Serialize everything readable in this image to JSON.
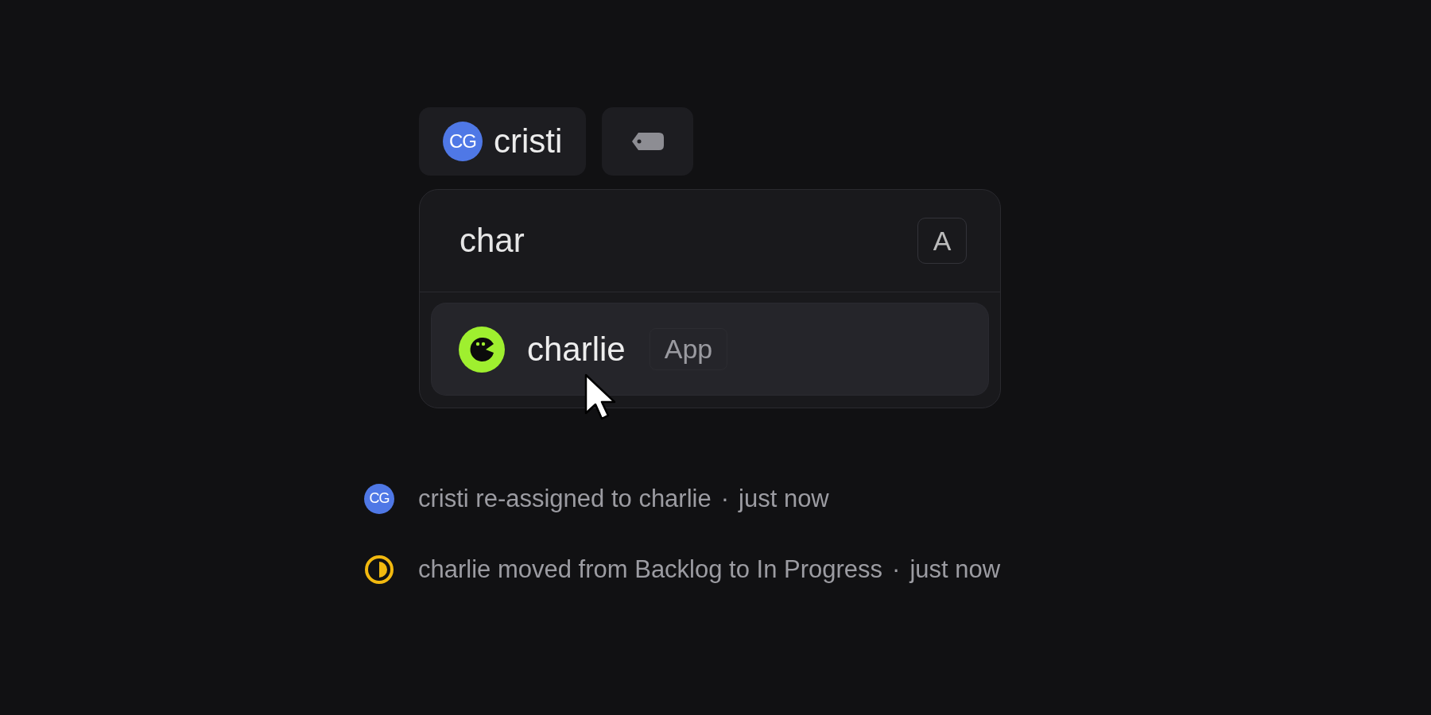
{
  "assignee": {
    "initials": "CG",
    "name": "cristi"
  },
  "search": {
    "value": "char",
    "shortcut": "A"
  },
  "options": [
    {
      "kind": "app",
      "name": "charlie",
      "badge": "App",
      "selected": true
    }
  ],
  "activity": [
    {
      "kind": "user",
      "initials": "CG",
      "message": "cristi re-assigned to charlie",
      "separator": "·",
      "time": "just now"
    },
    {
      "kind": "status",
      "message": "charlie moved from Backlog to In Progress",
      "separator": "·",
      "time": "just now"
    }
  ]
}
